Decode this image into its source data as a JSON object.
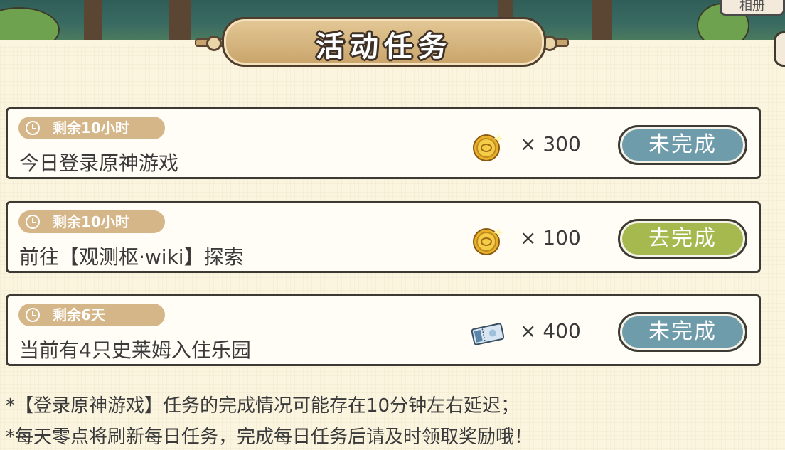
{
  "top_right_button": {
    "label": "相册"
  },
  "header": {
    "title": "活动任务"
  },
  "tasks": [
    {
      "countdown": "剩余10小时",
      "title": "今日登录原神游戏",
      "reward_icon": "gold-coin-icon",
      "reward_amount": "× 300",
      "status": "未完成",
      "status_color": "#6f9cab"
    },
    {
      "countdown": "剩余10小时",
      "title": "前往【观测枢·wiki】探索",
      "reward_icon": "gold-coin-icon",
      "reward_amount": "× 100",
      "status": "去完成",
      "status_color": "#a6b94e"
    },
    {
      "countdown": "剩余6天",
      "title": "当前有4只史莱姆入住乐园",
      "reward_icon": "ticket-icon",
      "reward_amount": "× 400",
      "status": "未完成",
      "status_color": "#6f9cab"
    }
  ],
  "notes": [
    "*【登录原神游戏】任务的完成情况可能存在10分钟左右延迟；",
    "*每天零点将刷新每日任务，完成每日任务后请及时领取奖励哦！"
  ],
  "colors": {
    "background": "#fbf5e0",
    "badge": "#d4b688",
    "undone": "#6f9cab",
    "go": "#a6b94e",
    "border": "#3c3a33"
  }
}
